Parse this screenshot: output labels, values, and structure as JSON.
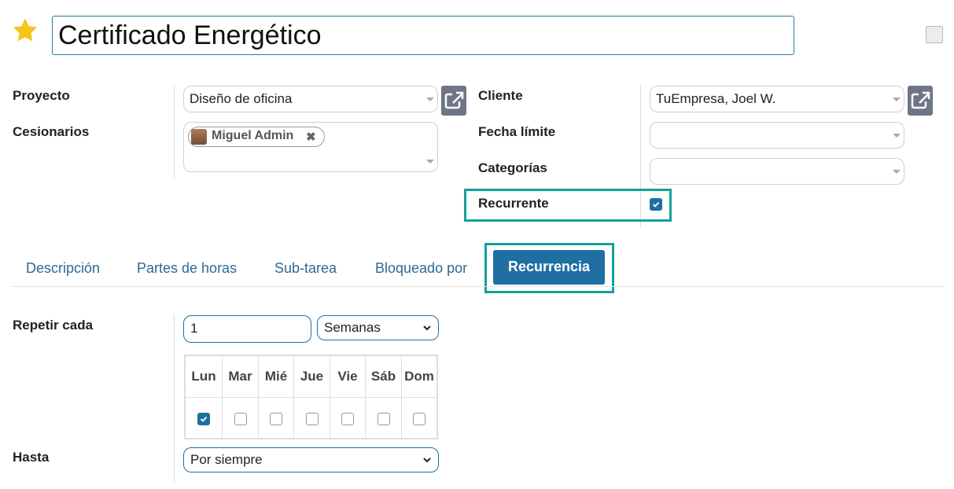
{
  "title": "Certificado Energético",
  "left_fields": {
    "project_label": "Proyecto",
    "project_value": "Diseño de oficina",
    "assignees_label": "Cesionarios",
    "assignee_tag": "Miguel Admin"
  },
  "right_fields": {
    "client_label": "Cliente",
    "client_value": "TuEmpresa, Joel W.",
    "deadline_label": "Fecha límite",
    "deadline_value": "",
    "categories_label": "Categorías",
    "categories_value": "",
    "recurrent_label": "Recurrente",
    "recurrent_checked": true
  },
  "tabs": [
    {
      "label": "Descripción",
      "active": false
    },
    {
      "label": "Partes de horas",
      "active": false
    },
    {
      "label": "Sub-tarea",
      "active": false
    },
    {
      "label": "Bloqueado por",
      "active": false
    },
    {
      "label": "Recurrencia",
      "active": true
    }
  ],
  "recurrence": {
    "repeat_label": "Repetir cada",
    "repeat_value": "1",
    "unit_value": "Semanas",
    "days": [
      {
        "name": "Lun",
        "checked": true
      },
      {
        "name": "Mar",
        "checked": false
      },
      {
        "name": "Mié",
        "checked": false
      },
      {
        "name": "Jue",
        "checked": false
      },
      {
        "name": "Vie",
        "checked": false
      },
      {
        "name": "Sáb",
        "checked": false
      },
      {
        "name": "Dom",
        "checked": false
      }
    ],
    "until_label": "Hasta",
    "until_value": "Por siempre"
  },
  "colors": {
    "accent": "#1f6fa3",
    "highlight": "#14a09a",
    "star": "#f5c518"
  },
  "icons": {
    "favorite": "star-icon",
    "external": "external-link-icon",
    "remove": "close-icon",
    "dropdown": "chevron-down-icon"
  }
}
